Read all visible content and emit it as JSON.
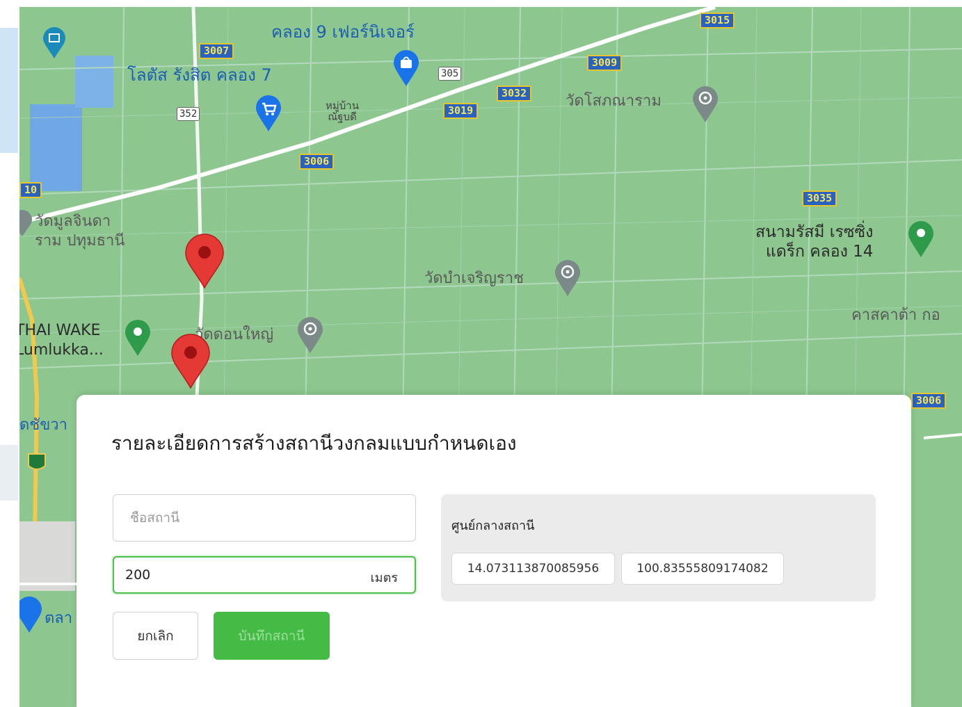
{
  "map": {
    "route_shields": [
      "3015",
      "3007",
      "3009",
      "3032",
      "3019",
      "3006",
      "3035",
      "3006",
      "10"
    ],
    "road_numbers": [
      "305",
      "352"
    ],
    "places": {
      "furniture_store": "คลอง 9 เฟอร์นิเจอร์",
      "lotus": "โลตัส รังสิต คลอง 7",
      "village": "หมู่บ้าน\nณัฐบดี",
      "wat_sopana": "วัดโสภณาราม",
      "wat_mun_chinda": "วัดมูลจินดา\nราม ปทุมธานี",
      "racetrack": "สนามรัสมี เรซซิ่ง\nแดร็ก คลอง 14",
      "wat_bamrung": "วัดบำเจริญราช",
      "thai_wake": "THAI WAKE\nLumlukka...",
      "wat_don_yai": "วัดดอนใหญ่",
      "cascata": "คาสคาต้า กอ",
      "edge_left": "ดชัขวา",
      "edge_market": "ตลา"
    },
    "colors": {
      "land": "#8dc78f",
      "pin": "#e53935",
      "poi_green": "#2e9b4a",
      "poi_gray": "#7b8a88",
      "poi_blue": "#1a73e8"
    }
  },
  "dialog": {
    "title": "รายละเอียดการสร้างสถานีวงกลมแบบกำหนดเอง",
    "station_name_placeholder": "ชื่อสถานี",
    "station_name_value": "",
    "radius_value": "200",
    "radius_unit": "เมตร",
    "cancel_label": "ยกเลิก",
    "save_label": "บันทึกสถานี",
    "center_label": "ศูนย์กลางสถานี",
    "center_lat": "14.073113870085956",
    "center_lng": "100.83555809174082"
  }
}
